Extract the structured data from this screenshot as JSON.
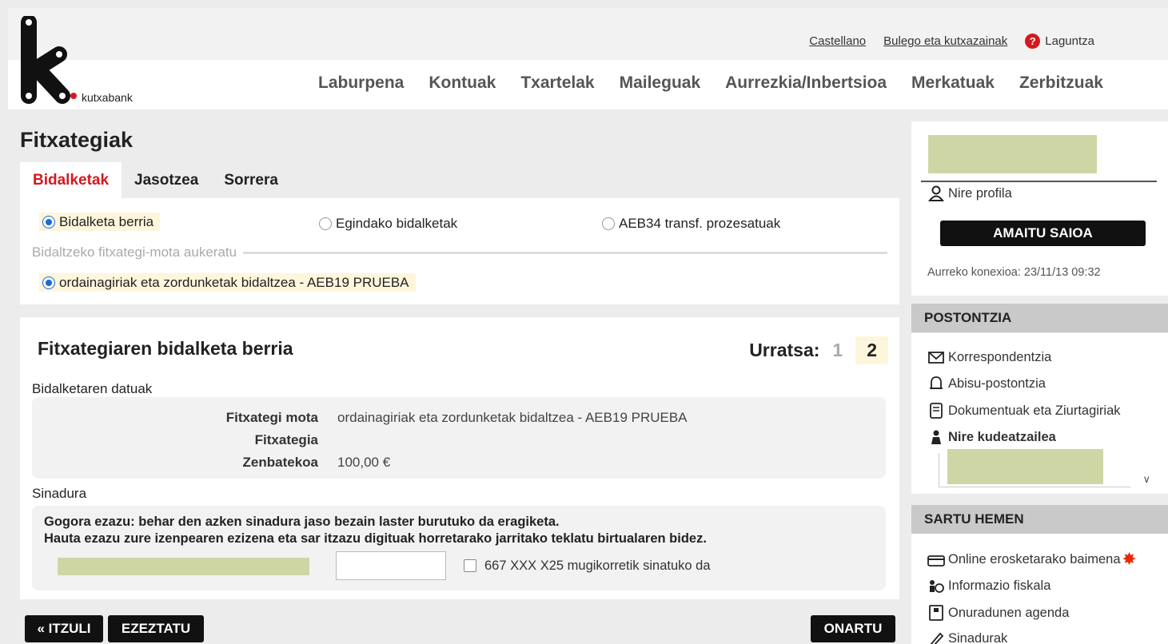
{
  "header": {
    "brand": "kutxabank",
    "links": [
      "Castellano",
      "Bulego eta kutxazainak"
    ],
    "help_label": "Laguntza",
    "nav": [
      "Laburpena",
      "Kontuak",
      "Txartelak",
      "Maileguak",
      "Aurrezkia/Inbertsioa",
      "Merkatuak",
      "Zerbitzuak"
    ]
  },
  "main": {
    "title": "Fitxategiak",
    "tabs": [
      "Bidalketak",
      "Jasotzea",
      "Sorrera"
    ],
    "options": [
      "Bidalketa berria",
      "Egindako bidalketak",
      "AEB34 transf. prozesatuak"
    ],
    "file_type_label": "Bidaltzeko fitxategi-mota aukeratu",
    "file_type_option": "ordainagiriak eta zordunketak bidaltzea - AEB19 PRUEBA",
    "form_title": "Fitxategiaren bidalketa berria",
    "step_label": "Urratsa:",
    "step_1": "1",
    "step_2": "2",
    "data_heading": "Bidalketaren datuak",
    "data_rows": [
      {
        "key": "Fitxategi mota",
        "value": "ordainagiriak eta zordunketak bidaltzea - AEB19 PRUEBA"
      },
      {
        "key": "Fitxategia",
        "value": ""
      },
      {
        "key": "Zenbatekoa",
        "value": "100,00 €"
      }
    ],
    "signature_heading": "Sinadura",
    "signature_text_1": "Gogora ezazu: behar den azken sinadura jaso bezain laster burutuko da eragiketa.",
    "signature_text_2": "Hauta ezazu zure izenpearen ezizena eta sar itzazu digituak horretarako jarritako teklatu birtualaren bidez.",
    "mobile_sign_label": "667 XXX X25 mugikorretik sinatuko da",
    "buttons": {
      "back": "« ITZULI",
      "cancel": "EZEZTATU",
      "accept": "ONARTU"
    }
  },
  "sidebar": {
    "profile": "Nire profila",
    "logout": "AMAITU SAIOA",
    "last_connection": "Aurreko konexioa: 23/11/13 09:32",
    "mailbox_heading": "POSTONTZIA",
    "mailbox_items": [
      "Korrespondentzia",
      "Abisu-postontzia",
      "Dokumentuak eta Ziurtagiriak",
      "Nire kudeatzailea"
    ],
    "enter_heading": "SARTU HEMEN",
    "enter_items": [
      "Online erosketarako baimena",
      "Informazio fiskala",
      "Onuradunen agenda",
      "Sinadurak"
    ],
    "colors": {
      "accent": "#d6181e",
      "redacted": "#cfd6a6"
    }
  }
}
